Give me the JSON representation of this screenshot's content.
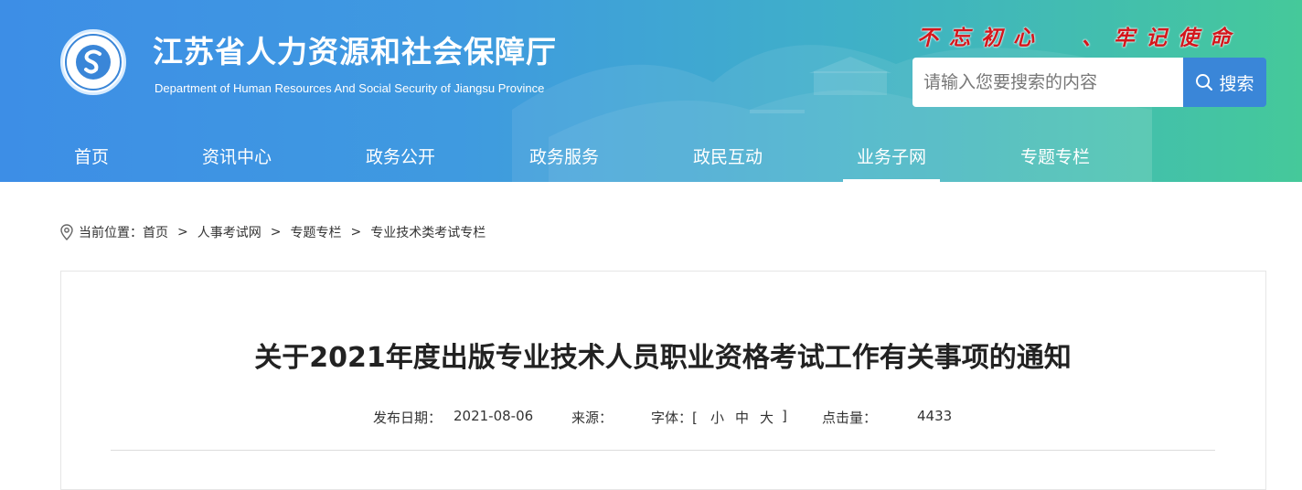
{
  "header": {
    "title": "江苏省人力资源和社会保障厅",
    "subtitle": "Department of Human Resources And Social Security of Jiangsu Province",
    "slogan": "不忘初心  、牢记使命",
    "logo_text": "江苏省人力资源和社会保障厅"
  },
  "search": {
    "placeholder": "请输入您要搜索的内容",
    "button_label": "搜索"
  },
  "nav": {
    "items": [
      "首页",
      "资讯中心",
      "政务公开",
      "政务服务",
      "政民互动",
      "业务子网",
      "专题专栏"
    ],
    "active": "业务子网"
  },
  "breadcrumb": {
    "prefix": "当前位置：",
    "items": [
      "首页",
      "人事考试网",
      "专题专栏",
      "专业技术类考试专栏"
    ],
    "separator": ">"
  },
  "article": {
    "title": "关于2021年度出版专业技术人员职业资格考试工作有关事项的通知",
    "publish_label": "发布日期：",
    "publish_date": "2021-08-06",
    "source_label": "来源：",
    "font_label": "字体：[",
    "font_small": "小",
    "font_medium": "中",
    "font_large": "大",
    "font_close": "]",
    "clicks_label": "点击量：",
    "clicks": "4433"
  },
  "colors": {
    "header_gradient_start": "#3d8ee6",
    "header_gradient_end": "#45c99a",
    "slogan": "#d4161c",
    "search_button": "#3a86d8"
  }
}
